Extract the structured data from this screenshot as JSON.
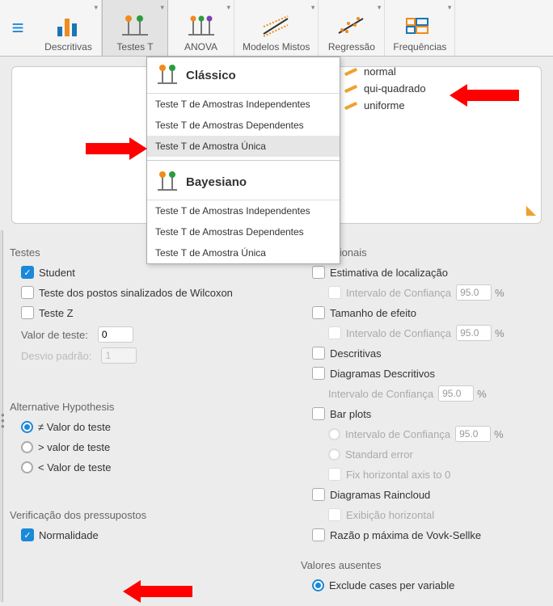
{
  "toolbar": {
    "items": [
      {
        "id": "descritivas",
        "label": "Descritivas"
      },
      {
        "id": "testes-t",
        "label": "Testes T"
      },
      {
        "id": "anova",
        "label": "ANOVA"
      },
      {
        "id": "modelos-mistos",
        "label": "Modelos Mistos"
      },
      {
        "id": "regressao",
        "label": "Regressão"
      },
      {
        "id": "frequencias",
        "label": "Frequências"
      }
    ]
  },
  "dropdown": {
    "classic_head": "Clássico",
    "classic_items": [
      "Teste T de Amostras Independentes",
      "Teste T de Amostras Dependentes",
      "Teste T de Amostra Única"
    ],
    "bayes_head": "Bayesiano",
    "bayes_items": [
      "Teste T de Amostras Independentes",
      "Teste T de Amostras Dependentes",
      "Teste T de Amostra Única"
    ]
  },
  "side_pop": {
    "items": [
      "normal",
      "qui-quadrado",
      "uniforme"
    ]
  },
  "left": {
    "testes_head": "Testes",
    "student": "Student",
    "wilcoxon": "Teste dos postos sinalizados de Wilcoxon",
    "testez": "Teste Z",
    "valor_teste_lbl": "Valor de teste:",
    "valor_teste_val": "0",
    "desvio_lbl": "Desvio padrão:",
    "desvio_val": "1",
    "alt_head": "Alternative Hypothesis",
    "alt_ne": "≠ Valor do teste",
    "alt_gt": "> valor de teste",
    "alt_lt": "< Valor de teste",
    "assump_head": "Verificação dos pressupostos",
    "normalidade": "Normalidade"
  },
  "right": {
    "stats_head": "cas adicionais",
    "est_loc": "Estimativa de localização",
    "ci": "Intervalo de Confiança",
    "ci_val": "95.0",
    "tam_efeito": "Tamanho de efeito",
    "descritivas": "Descritivas",
    "diag_desc": "Diagramas Descritivos",
    "bar": "Bar plots",
    "std_err": "Standard error",
    "fix_axis": "Fix horizontal axis to 0",
    "raincloud": "Diagramas Raincloud",
    "exib_horiz": "Exibição horizontal",
    "vovk": "Razão p máxima de Vovk-Sellke",
    "missing_head": "Valores ausentes",
    "exclude": "Exclude cases per variable"
  }
}
